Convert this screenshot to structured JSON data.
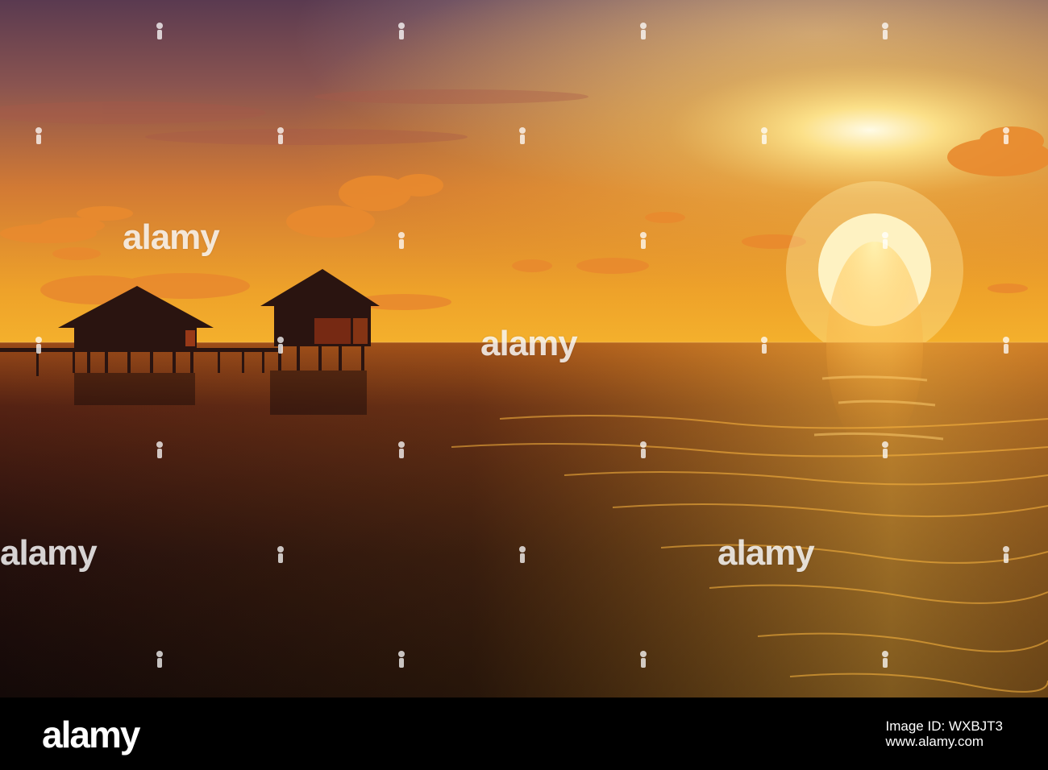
{
  "watermark": {
    "brand": "alamy"
  },
  "footer": {
    "logo": "alamy",
    "image_id_line": "Image ID: WXBJT3",
    "site": "www.alamy.com"
  },
  "colors": {
    "sky_top": "#5e3a4c",
    "sky_glow": "#f0a020",
    "sun": "#fff6c8",
    "sea": "#2a1310",
    "footer_bg": "#000000"
  }
}
